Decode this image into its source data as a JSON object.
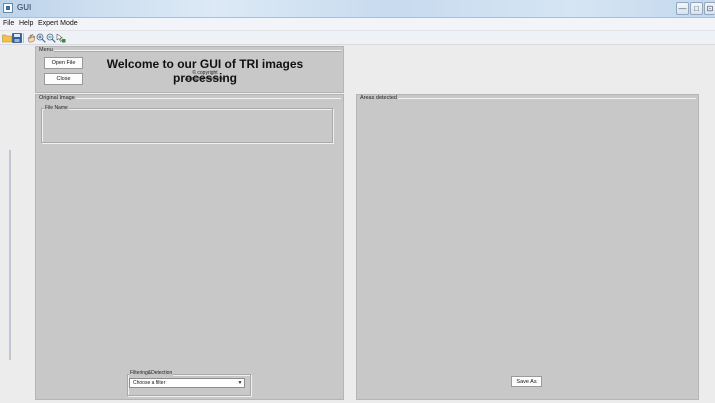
{
  "window": {
    "title": "GUI"
  },
  "titlebar_buttons": [
    "—",
    "□",
    "⊡"
  ],
  "menubar": {
    "items": [
      "File",
      "Help",
      "Expert Mode"
    ]
  },
  "toolbar": {
    "icons": [
      "open-folder-icon",
      "save-icon",
      "pan-hand-icon",
      "zoom-in-icon",
      "zoom-out-icon",
      "data-cursor-icon"
    ]
  },
  "menu_panel": {
    "title": "Menu",
    "open_label": "Open File",
    "close_label": "Close",
    "welcome": "Welcome to our GUI of TRI images processing",
    "copyright": "© copyright",
    "rights": "All rights reserved"
  },
  "original_panel": {
    "title": "Original Image",
    "file_name_label": "File Name"
  },
  "filter_group": {
    "label": "Filtering&Detection",
    "select_value": "Choose a filter",
    "options": [
      "Choose a filter"
    ]
  },
  "areas_panel": {
    "title": "Areas detected",
    "save_label": "Save As"
  },
  "colors": {
    "panel": "#c8c8c8",
    "titlebar": "#cfe0f1"
  }
}
